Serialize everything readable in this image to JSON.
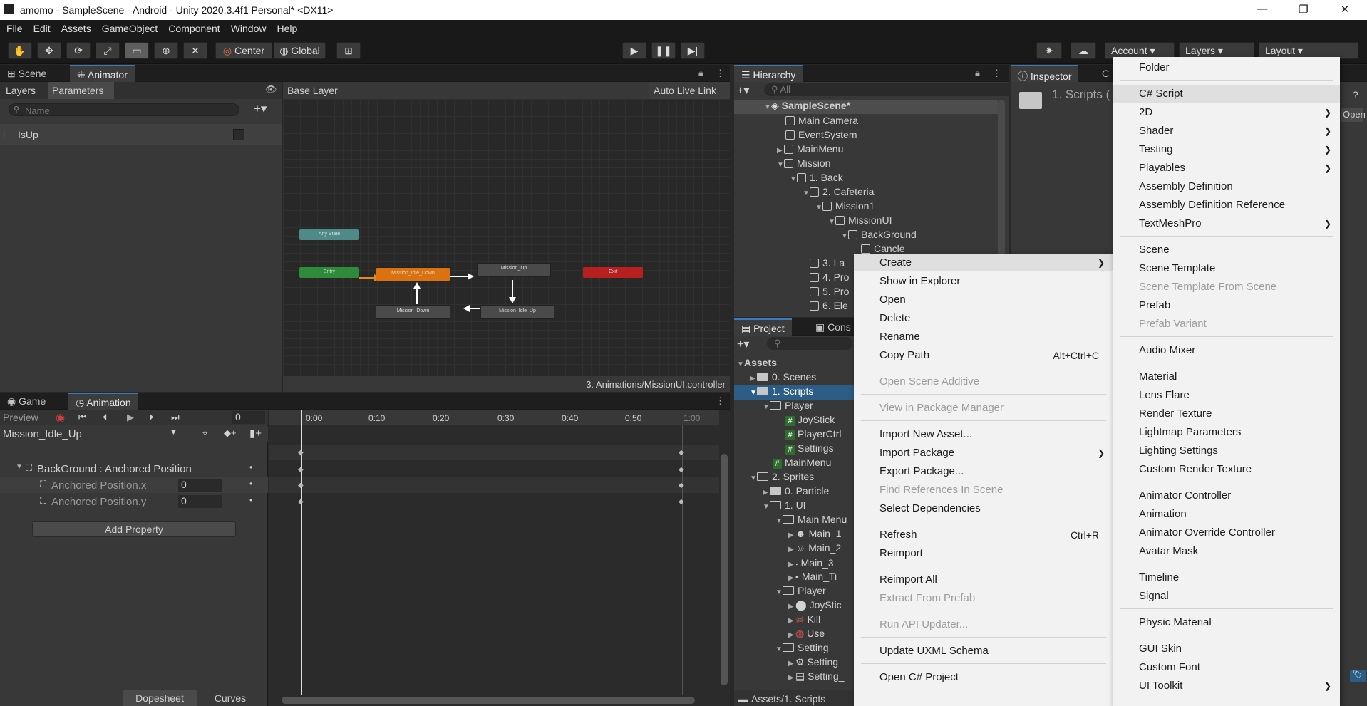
{
  "window": {
    "title": "amomo - SampleScene - Android - Unity 2020.3.4f1 Personal* <DX11>",
    "minimize": "—",
    "maximize": "❐",
    "close": "✕"
  },
  "menubar": [
    "File",
    "Edit",
    "Assets",
    "GameObject",
    "Component",
    "Window",
    "Help"
  ],
  "toolbar": {
    "center": "Center",
    "global": "Global",
    "account": "Account",
    "layers": "Layers",
    "layout": "Layout"
  },
  "scene_panel": {
    "tabs": [
      "Scene",
      "Animator"
    ]
  },
  "animator": {
    "subtabs": [
      "Layers",
      "Parameters"
    ],
    "search_placeholder": "Name",
    "param_name": "IsUp",
    "breadcrumb": "Base Layer",
    "auto_live_link": "Auto Live Link",
    "footer_path": "3. Animations/MissionUI.controller",
    "states": {
      "any": "Any State",
      "entry": "Entry",
      "idle_down": "Mission_Idle_Down",
      "up": "Mission_Up",
      "exit": "Exit",
      "down": "Mission_Down",
      "idle_up": "Mission_Idle_Up"
    }
  },
  "hierarchy": {
    "tab": "Hierarchy",
    "search_placeholder": "All",
    "items": [
      "SampleScene*",
      "Main Camera",
      "EventSystem",
      "MainMenu",
      "Mission",
      "1. Back",
      "2. Cafeteria",
      "Mission1",
      "MissionUI",
      "BackGround",
      "Cancle",
      "3. La",
      "4. Pro",
      "5. Pro",
      "6. Ele"
    ]
  },
  "inspector": {
    "tab": "Inspector",
    "tab2": "C",
    "title": "1. Scripts (",
    "open": "Open"
  },
  "game_panel": {
    "tabs": [
      "Game",
      "Animation"
    ]
  },
  "animation": {
    "preview": "Preview",
    "frame": "0",
    "clip": "Mission_Idle_Up",
    "ticks": [
      "0:00",
      "0:10",
      "0:20",
      "0:30",
      "0:40",
      "0:50",
      "1:00"
    ],
    "property_group": "BackGround : Anchored Position",
    "properties": [
      {
        "name": "Anchored Position.x",
        "value": "0"
      },
      {
        "name": "Anchored Position.y",
        "value": "0"
      }
    ],
    "add_property": "Add Property",
    "dopesheet": "Dopesheet",
    "curves": "Curves"
  },
  "project": {
    "tabs": [
      "Project",
      "Cons"
    ],
    "items": [
      "Assets",
      "0. Scenes",
      "1. Scripts",
      "Player",
      "JoyStick",
      "PlayerCtrl",
      "Settings",
      "MainMenu",
      "2. Sprites",
      "0. Particle",
      "1. UI",
      "Main Menu",
      "Main_1",
      "Main_2",
      "Main_3",
      "Main_Ti",
      "Player",
      "JoyStic",
      "Kill",
      "Use",
      "Setting",
      "Setting",
      "Setting_"
    ],
    "footer": "Assets/1. Scripts"
  },
  "context_menu": [
    {
      "label": "Create",
      "sub": true
    },
    {
      "label": "Show in Explorer"
    },
    {
      "label": "Open"
    },
    {
      "label": "Delete"
    },
    {
      "label": "Rename"
    },
    {
      "label": "Copy Path",
      "shortcut": "Alt+Ctrl+C"
    },
    {
      "label": "Open Scene Additive",
      "disabled": true
    },
    {
      "label": "View in Package Manager",
      "disabled": true
    },
    {
      "label": "Import New Asset..."
    },
    {
      "label": "Import Package",
      "sub": true
    },
    {
      "label": "Export Package..."
    },
    {
      "label": "Find References In Scene",
      "disabled": true
    },
    {
      "label": "Select Dependencies"
    },
    {
      "label": "Refresh",
      "shortcut": "Ctrl+R"
    },
    {
      "label": "Reimport"
    },
    {
      "label": "Reimport All"
    },
    {
      "label": "Extract From Prefab",
      "disabled": true
    },
    {
      "label": "Run API Updater...",
      "disabled": true
    },
    {
      "label": "Update UXML Schema"
    },
    {
      "label": "Open C# Project"
    }
  ],
  "create_menu": [
    {
      "label": "Folder"
    },
    {
      "label": "C# Script"
    },
    {
      "label": "2D",
      "sub": true
    },
    {
      "label": "Shader",
      "sub": true
    },
    {
      "label": "Testing",
      "sub": true
    },
    {
      "label": "Playables",
      "sub": true
    },
    {
      "label": "Assembly Definition"
    },
    {
      "label": "Assembly Definition Reference"
    },
    {
      "label": "TextMeshPro",
      "sub": true
    },
    {
      "label": "Scene"
    },
    {
      "label": "Scene Template"
    },
    {
      "label": "Scene Template From Scene",
      "disabled": true
    },
    {
      "label": "Prefab"
    },
    {
      "label": "Prefab Variant",
      "disabled": true
    },
    {
      "label": "Audio Mixer"
    },
    {
      "label": "Material"
    },
    {
      "label": "Lens Flare"
    },
    {
      "label": "Render Texture"
    },
    {
      "label": "Lightmap Parameters"
    },
    {
      "label": "Lighting Settings"
    },
    {
      "label": "Custom Render Texture"
    },
    {
      "label": "Animator Controller"
    },
    {
      "label": "Animation"
    },
    {
      "label": "Animator Override Controller"
    },
    {
      "label": "Avatar Mask"
    },
    {
      "label": "Timeline"
    },
    {
      "label": "Signal"
    },
    {
      "label": "Physic Material"
    },
    {
      "label": "GUI Skin"
    },
    {
      "label": "Custom Font"
    },
    {
      "label": "UI Toolkit",
      "sub": true
    }
  ]
}
